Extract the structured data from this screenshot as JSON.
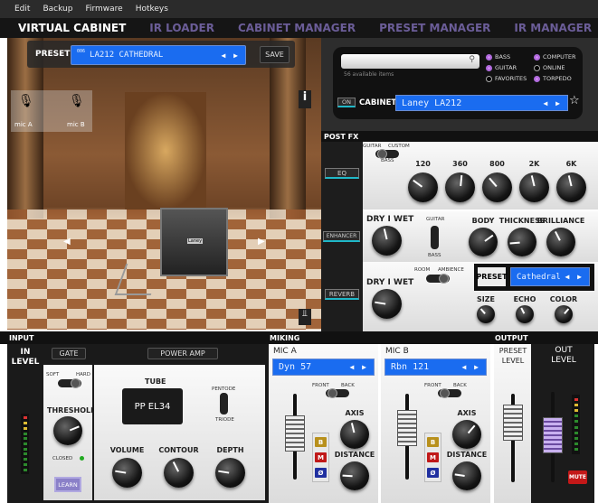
{
  "menu": [
    "Edit",
    "Backup",
    "Firmware",
    "Hotkeys"
  ],
  "tabs": [
    "VIRTUAL CABINET",
    "IR LOADER",
    "CABINET MANAGER",
    "PRESET MANAGER",
    "IR MANAGER"
  ],
  "preset": {
    "label": "PRESET",
    "number": "006",
    "name": "LA212 CATHEDRAL",
    "save": "SAVE"
  },
  "scene": {
    "mic_a": "mic A",
    "mic_b": "mic B",
    "info": "i",
    "cab_logo": "Laney"
  },
  "browser": {
    "search_placeholder": "",
    "count": "56 available items",
    "filters": [
      {
        "label": "BASS",
        "on": true
      },
      {
        "label": "COMPUTER",
        "on": true
      },
      {
        "label": "GUITAR",
        "on": true
      },
      {
        "label": "ONLINE",
        "on": false
      },
      {
        "label": "FAVORITES",
        "on": false
      },
      {
        "label": "TORPEDO",
        "on": true
      }
    ],
    "on": "ON",
    "cabinet_label": "CABINET",
    "cabinet": "Laney LA212"
  },
  "postfx": {
    "title": "POST FX",
    "eq": {
      "button": "EQ",
      "toggle": [
        "GUITAR",
        "CUSTOM",
        "BASS"
      ],
      "bands": [
        {
          "label": "120",
          "value": 0.3
        },
        {
          "label": "360",
          "value": 0.52
        },
        {
          "label": "800",
          "value": 0.35
        },
        {
          "label": "2K",
          "value": 0.45
        },
        {
          "label": "6K",
          "value": 0.45
        }
      ]
    },
    "enhancer": {
      "button": "ENHANCER",
      "drywet": "DRY I WET",
      "drywet_value": 0.45,
      "toggle": [
        "GUITAR",
        "BASS"
      ],
      "knobs": [
        {
          "label": "BODY",
          "value": 0.7
        },
        {
          "label": "THICKNESS",
          "value": 0.15
        },
        {
          "label": "BRILLIANCE",
          "value": 0.4
        }
      ]
    },
    "reverb": {
      "button": "REVERB",
      "drywet": "DRY I WET",
      "drywet_value": 0.2,
      "toggle": [
        "ROOM",
        "AMBIENCE"
      ],
      "preset_label": "PRESET",
      "preset": "Cathedral",
      "knobs": [
        {
          "label": "SIZE",
          "value": 0.35
        },
        {
          "label": "ECHO",
          "value": 0.4
        },
        {
          "label": "COLOR",
          "value": 0.65
        }
      ]
    }
  },
  "input": {
    "title": "INPUT",
    "in_level": "IN LEVEL",
    "gate": "GATE",
    "soft": "SOFT",
    "hard": "HARD",
    "threshold": "THRESHOLD",
    "threshold_value": 0.75,
    "closed": "CLOSED",
    "learn": "LEARN"
  },
  "poweramp": {
    "title": "POWER AMP",
    "tube_label": "TUBE",
    "tube": "PP EL34",
    "pentode": "PENTODE",
    "triode": "TRIODE",
    "knobs": [
      {
        "label": "VOLUME",
        "value": 0.2
      },
      {
        "label": "CONTOUR",
        "value": 0.4
      },
      {
        "label": "DEPTH",
        "value": 0.2
      }
    ]
  },
  "miking": {
    "title": "MIKING",
    "front": "FRONT",
    "back": "BACK",
    "axis": "AXIS",
    "distance": "DISTANCE",
    "b": "B",
    "m": "M",
    "phase": "Ø",
    "mics": [
      {
        "title": "MIC A",
        "model": "Dyn 57",
        "axis_value": 0.45,
        "distance_value": 0.18
      },
      {
        "title": "MIC B",
        "model": "Rbn 121",
        "axis_value": 0.65,
        "distance_value": 0.2
      }
    ]
  },
  "output": {
    "title": "OUTPUT",
    "preset_level": "PRESET LEVEL",
    "out_level": "OUT LEVEL",
    "mute": "MUTE"
  },
  "colors": {
    "display": "#1a6cf0",
    "accent": "#20b8c8",
    "tab_inactive": "#6b5d98"
  }
}
